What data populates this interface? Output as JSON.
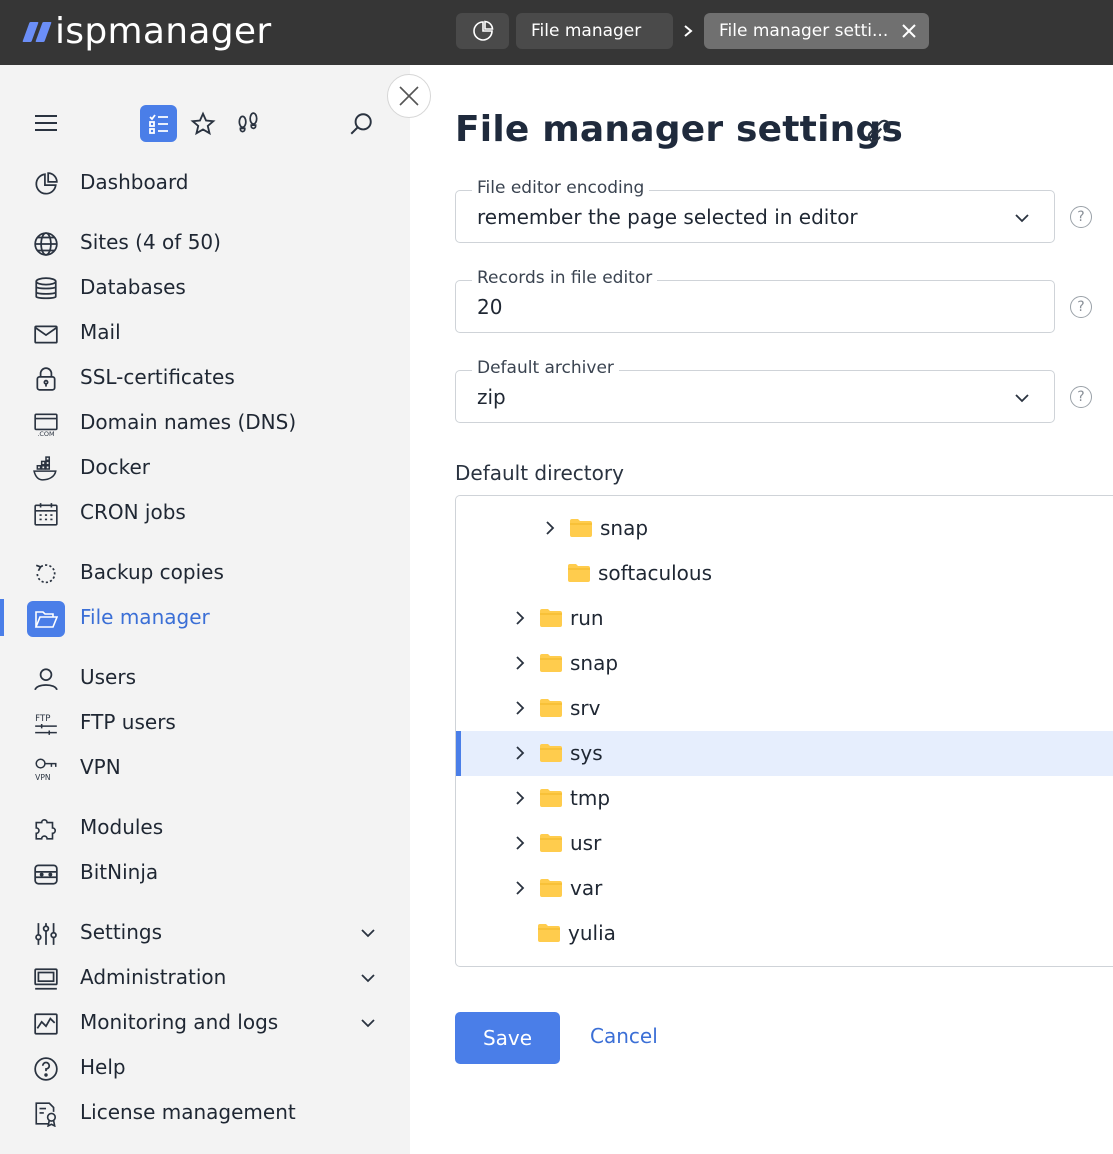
{
  "brand": {
    "name": "ispmanager",
    "accent": "#4a7ee8",
    "topbar_bg": "#363636"
  },
  "breadcrumbs": {
    "home_icon": "dashboard-pie-icon",
    "items": [
      {
        "label": "File manager"
      },
      {
        "label": "File manager setti..."
      }
    ]
  },
  "sidebar": {
    "tools": [
      "menu-icon",
      "list-icon",
      "star-icon",
      "footprints-icon",
      "search-icon"
    ],
    "items": [
      {
        "label": "Dashboard",
        "icon": "pie-chart-icon"
      },
      {
        "label": "Sites (4 of 50)",
        "icon": "globe-icon"
      },
      {
        "label": "Databases",
        "icon": "database-icon"
      },
      {
        "label": "Mail",
        "icon": "mail-icon"
      },
      {
        "label": "SSL-certificates",
        "icon": "lock-icon"
      },
      {
        "label": "Domain names (DNS)",
        "icon": "dns-icon"
      },
      {
        "label": "Docker",
        "icon": "docker-icon"
      },
      {
        "label": "CRON jobs",
        "icon": "calendar-icon"
      },
      {
        "label": "Backup copies",
        "icon": "backup-icon"
      },
      {
        "label": "File manager",
        "icon": "folder-icon",
        "active": true
      },
      {
        "label": "Users",
        "icon": "user-icon"
      },
      {
        "label": "FTP users",
        "icon": "ftp-icon"
      },
      {
        "label": "VPN",
        "icon": "vpn-icon"
      },
      {
        "label": "Modules",
        "icon": "puzzle-icon"
      },
      {
        "label": "BitNinja",
        "icon": "bitninja-icon"
      },
      {
        "label": "Settings",
        "icon": "sliders-icon",
        "expandable": true
      },
      {
        "label": "Administration",
        "icon": "monitor-icon",
        "expandable": true
      },
      {
        "label": "Monitoring and logs",
        "icon": "chart-line-icon",
        "expandable": true
      },
      {
        "label": "Help",
        "icon": "help-icon"
      },
      {
        "label": "License management",
        "icon": "license-icon"
      }
    ]
  },
  "page": {
    "title": "File manager settings",
    "fields": {
      "encoding": {
        "label": "File editor encoding",
        "value": "remember the page selected in editor"
      },
      "records": {
        "label": "Records in file editor",
        "value": "20"
      },
      "archiver": {
        "label": "Default archiver",
        "value": "zip"
      }
    },
    "directory_label": "Default directory",
    "tree": [
      {
        "name": "snap",
        "expandable": true,
        "depth": 3
      },
      {
        "name": "softaculous",
        "expandable": false,
        "depth": 3
      },
      {
        "name": "run",
        "expandable": true,
        "depth": 2
      },
      {
        "name": "snap",
        "expandable": true,
        "depth": 2
      },
      {
        "name": "srv",
        "expandable": true,
        "depth": 2
      },
      {
        "name": "sys",
        "expandable": true,
        "depth": 2,
        "selected": true
      },
      {
        "name": "tmp",
        "expandable": true,
        "depth": 2
      },
      {
        "name": "usr",
        "expandable": true,
        "depth": 2
      },
      {
        "name": "var",
        "expandable": true,
        "depth": 2
      },
      {
        "name": "yulia",
        "expandable": false,
        "depth": 2
      }
    ],
    "save_label": "Save",
    "cancel_label": "Cancel",
    "help_glyph": "?"
  }
}
